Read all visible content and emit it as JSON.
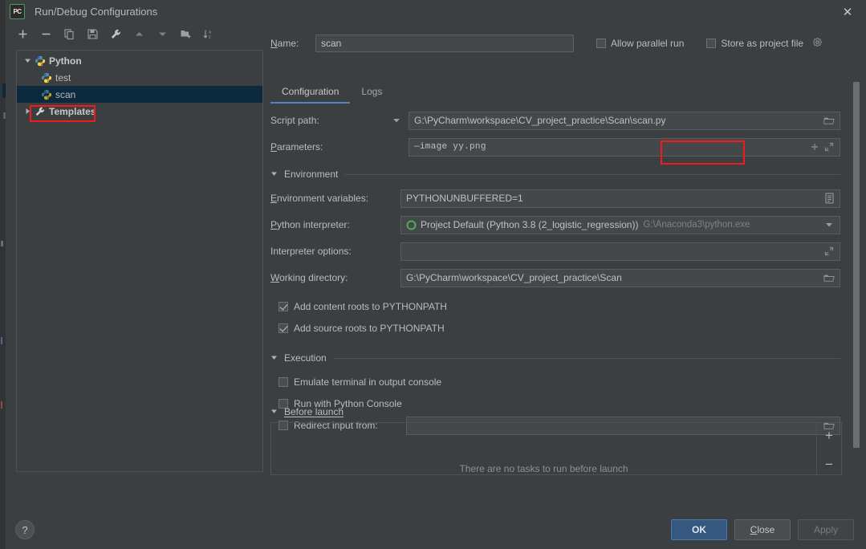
{
  "window": {
    "title": "Run/Debug Configurations",
    "logo_text": "PC",
    "close_label": "✕"
  },
  "toolbar": {
    "icons": [
      {
        "name": "add-icon",
        "label": "+"
      },
      {
        "name": "remove-icon",
        "label": "−"
      },
      {
        "name": "copy-icon",
        "label": "Copy"
      },
      {
        "name": "save-icon",
        "label": "Save"
      },
      {
        "name": "edit-templates-icon",
        "label": "Edit Templates"
      },
      {
        "name": "move-up-icon",
        "label": "Move Up"
      },
      {
        "name": "move-down-icon",
        "label": "Move Down"
      },
      {
        "name": "new-folder-icon",
        "label": "New Folder"
      },
      {
        "name": "sort-alphabetically-icon",
        "label": "Sort"
      }
    ]
  },
  "tree": {
    "nodes": [
      {
        "label": "Python",
        "icon": "python-icon",
        "expanded": true,
        "bold": true,
        "selected": false,
        "indent": 0
      },
      {
        "label": "test",
        "icon": "python-icon",
        "bold": false,
        "selected": false,
        "indent": 1
      },
      {
        "label": "scan",
        "icon": "python-icon",
        "bold": false,
        "selected": true,
        "indent": 1
      },
      {
        "label": "Templates",
        "icon": "wrench-icon",
        "expanded": false,
        "bold": true,
        "selected": false,
        "indent": 0
      }
    ]
  },
  "header": {
    "name_label": "Name:",
    "name_value": "scan",
    "allow_parallel_run": {
      "label": "Allow parallel run",
      "checked": false
    },
    "store_as_project_file": {
      "label": "Store as project file",
      "checked": false
    }
  },
  "tabs": [
    {
      "label": "Configuration",
      "active": true
    },
    {
      "label": "Logs",
      "active": false
    }
  ],
  "form": {
    "script_path": {
      "label": "Script path:",
      "value": "G:\\PyCharm\\workspace\\CV_project_practice\\Scan\\scan.py"
    },
    "parameters": {
      "label": "Parameters:",
      "value": "—image yy.png"
    },
    "environment_section": "Environment",
    "environment_variables": {
      "label": "Environment variables:",
      "value": "PYTHONUNBUFFERED=1"
    },
    "python_interpreter": {
      "label": "Python interpreter:",
      "value": "Project Default (Python 3.8 (2_logistic_regression))",
      "path": "G:\\Anaconda3\\python.exe"
    },
    "interpreter_options": {
      "label": "Interpreter options:",
      "value": ""
    },
    "working_directory": {
      "label": "Working directory:",
      "value": "G:\\PyCharm\\workspace\\CV_project_practice\\Scan"
    },
    "add_content_roots": {
      "label": "Add content roots to PYTHONPATH",
      "checked": true
    },
    "add_source_roots": {
      "label": "Add source roots to PYTHONPATH",
      "checked": true
    },
    "execution_section": "Execution",
    "emulate_terminal": {
      "label": "Emulate terminal in output console",
      "checked": false
    },
    "run_with_python_console": {
      "label": "Run with Python Console",
      "checked": false
    },
    "redirect_input": {
      "label": "Redirect input from:",
      "checked": false,
      "value": ""
    }
  },
  "before_launch": {
    "title": "Before launch",
    "add_label": "+",
    "remove_label": "−",
    "clipped_text": "There are no tasks to run before launch"
  },
  "footer": {
    "help_label": "?",
    "ok_label": "OK",
    "close_label": "Close",
    "apply_label": "Apply"
  },
  "colors": {
    "accent_blue": "#4a88c7",
    "primary_button": "#365880",
    "selection": "#0d293e",
    "highlight_red": "#f31a1a",
    "background": "#3c3f41"
  }
}
